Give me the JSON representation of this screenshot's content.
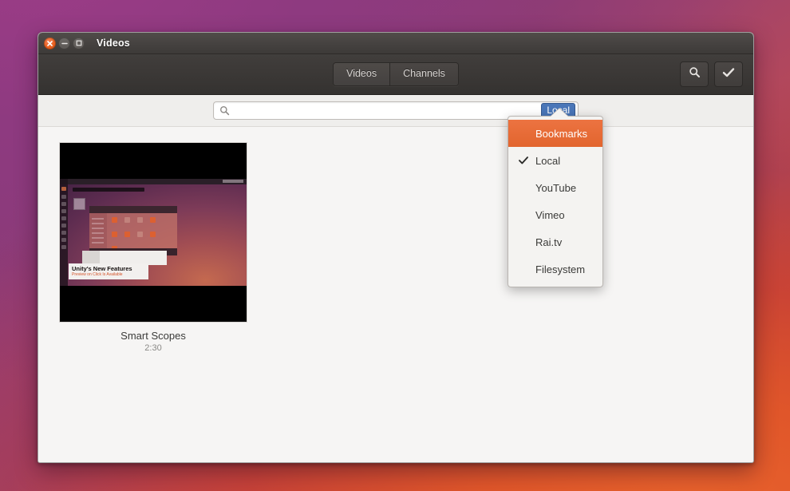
{
  "window": {
    "title": "Videos",
    "controls": [
      {
        "name": "close",
        "icon": "close-icon"
      },
      {
        "name": "minimize",
        "icon": "minimize-icon"
      },
      {
        "name": "maximize",
        "icon": "maximize-icon"
      }
    ]
  },
  "toolbar": {
    "tabs": [
      {
        "label": "Videos",
        "active": true
      },
      {
        "label": "Channels",
        "active": false
      }
    ],
    "search_button_icon": "search-icon",
    "confirm_button_icon": "check-icon"
  },
  "search": {
    "placeholder": "",
    "value": "",
    "icon": "search-icon",
    "source_badge": "Local"
  },
  "dropdown": {
    "items": [
      {
        "label": "Bookmarks",
        "checked": false,
        "highlighted": true
      },
      {
        "label": "Local",
        "checked": true,
        "highlighted": false
      },
      {
        "label": "YouTube",
        "checked": false,
        "highlighted": false
      },
      {
        "label": "Vimeo",
        "checked": false,
        "highlighted": false
      },
      {
        "label": "Rai.tv",
        "checked": false,
        "highlighted": false
      },
      {
        "label": "Filesystem",
        "checked": false,
        "highlighted": false
      }
    ]
  },
  "content": {
    "videos": [
      {
        "title": "Smart Scopes",
        "duration": "2:30",
        "thumbnail_caption_title": "Unity's New Features",
        "thumbnail_caption_subtitle": "Preview on Click Is Available"
      }
    ]
  },
  "colors": {
    "accent_orange": "#e2652e",
    "badge_blue": "#4a76b8",
    "titlebar_dark": "#454240",
    "content_bg": "#f6f5f4"
  }
}
